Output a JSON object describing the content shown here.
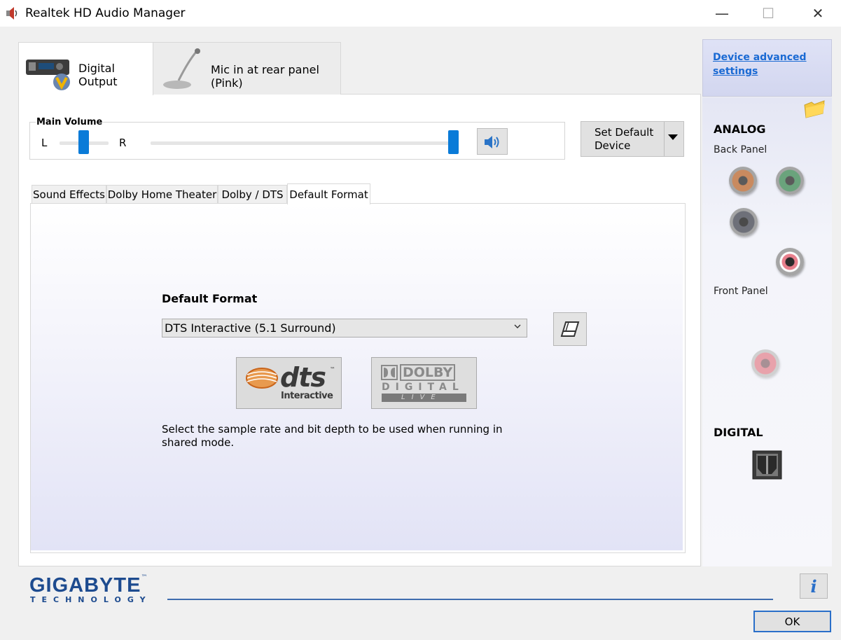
{
  "window": {
    "title": "Realtek HD Audio Manager",
    "minimize_glyph": "—",
    "maximize_glyph": "☐",
    "close_glyph": "✕"
  },
  "device_tabs": [
    {
      "label": "Digital Output",
      "icon": "receiver-icon",
      "active": true
    },
    {
      "label": "Mic in at rear panel (Pink)",
      "icon": "microphone-icon",
      "active": false
    }
  ],
  "volume": {
    "title": "Main Volume",
    "left_label": "L",
    "right_label": "R",
    "balance": 0.5,
    "level": 1.0
  },
  "set_default": {
    "label_line1": "Set Default",
    "label_line2": "Device"
  },
  "sub_tabs": [
    {
      "label": "Sound Effects",
      "active": false
    },
    {
      "label": "Dolby Home Theater",
      "active": false
    },
    {
      "label": "Dolby / DTS",
      "active": false
    },
    {
      "label": "Default Format",
      "active": true
    }
  ],
  "default_format": {
    "heading": "Default Format",
    "selected": "DTS Interactive (5.1 Surround)",
    "description": "Select the sample rate and bit depth to be used when running in shared mode.",
    "dts_logo": {
      "word": "dts",
      "sub": "Interactive",
      "tm": "™"
    },
    "dolby_logo": {
      "word": "DOLBY",
      "line2": "DIGITAL",
      "line3": "LIVE"
    }
  },
  "right_panel": {
    "advanced_link_line1": "Device advanced",
    "advanced_link_line2": "settings",
    "analog_heading": "ANALOG",
    "back_panel": "Back Panel",
    "front_panel": "Front Panel",
    "digital_heading": "DIGITAL",
    "jack_colors": {
      "orange": "#c98a5f",
      "green": "#6aa37c",
      "gray": "#6e7079",
      "pink": "#e87f8c",
      "pink_faded": "#e8a2ab"
    }
  },
  "footer": {
    "brand": "GIGABYTE",
    "brand_tm": "™",
    "brand_sub": "TECHNOLOGY",
    "ok_label": "OK",
    "info_glyph": "i"
  },
  "colors": {
    "accent": "#0a7bd8",
    "link": "#1a6ad3",
    "brand": "#1d4b8f"
  }
}
